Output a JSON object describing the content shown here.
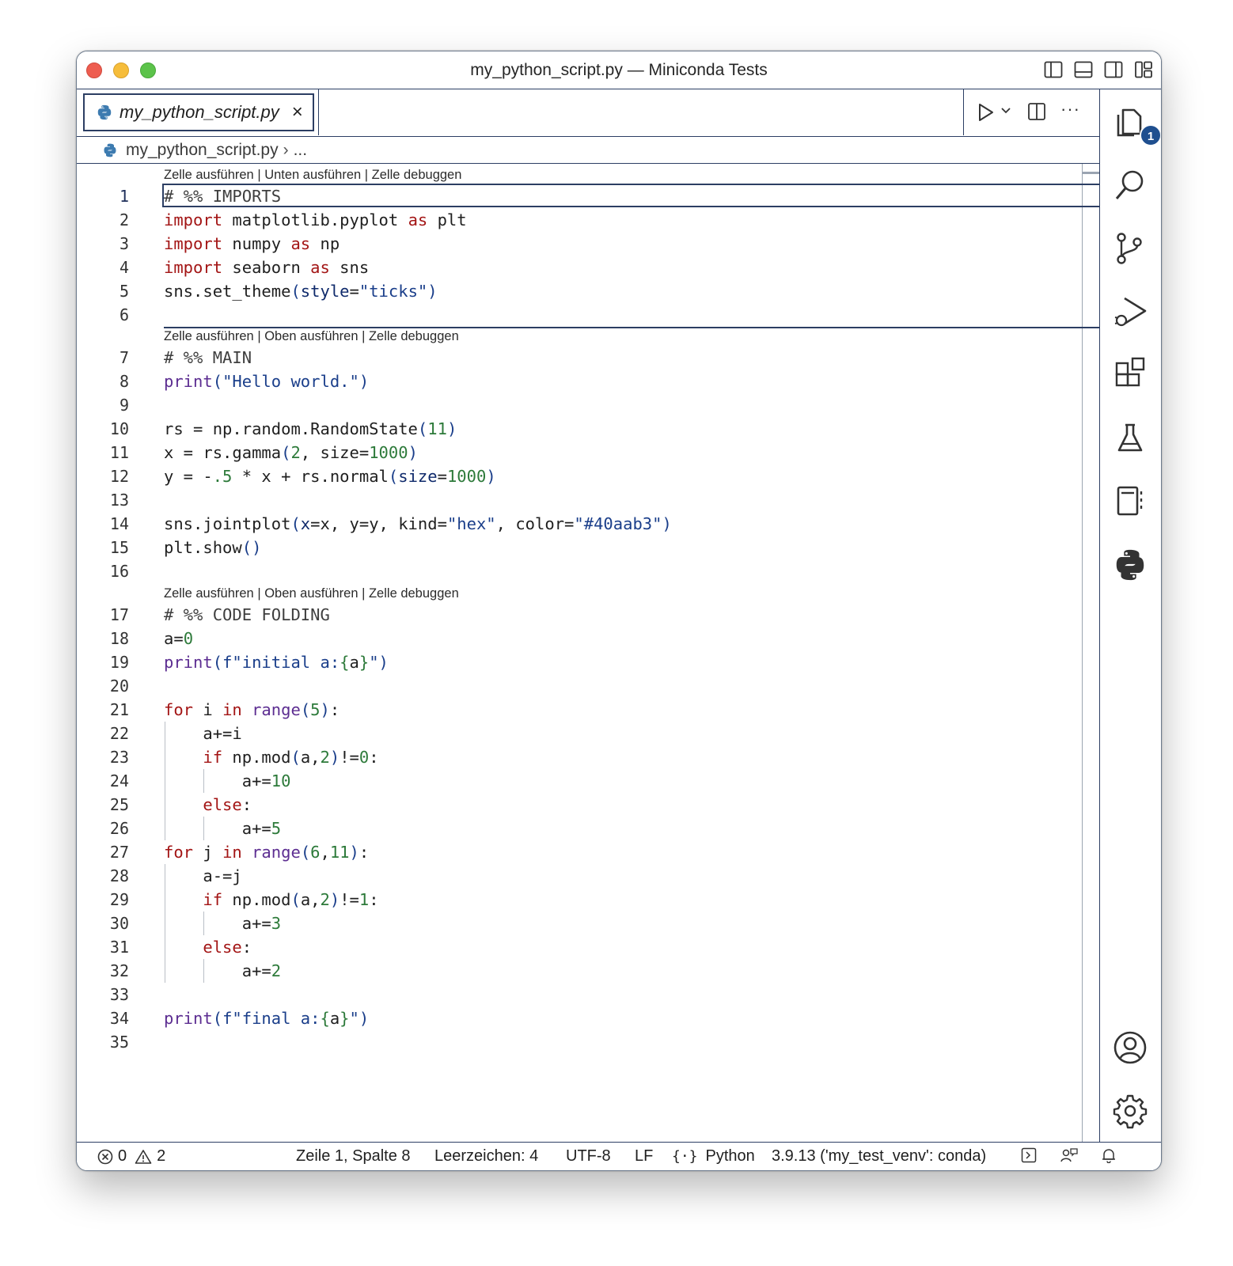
{
  "window": {
    "title": "my_python_script.py — Miniconda Tests"
  },
  "tab": {
    "filename": "my_python_script.py",
    "close_glyph": "×"
  },
  "breadcrumb": {
    "file": "my_python_script.py",
    "separator": "›",
    "more": "..."
  },
  "activity_bar": {
    "items": [
      "explorer-icon",
      "search-icon",
      "source-control-icon",
      "run-debug-icon",
      "extensions-icon",
      "testing-icon",
      "notebook-icon",
      "python-icon"
    ],
    "explorer_badge": "1",
    "bottom": [
      "accounts-icon",
      "settings-gear-icon"
    ]
  },
  "editor_actions": {
    "more": "···"
  },
  "codelens": {
    "first": "Zelle ausführen | Unten ausführen | Zelle debuggen",
    "second": "Zelle ausführen | Oben ausführen | Zelle debuggen",
    "third": "Zelle ausführen | Oben ausführen | Zelle debuggen"
  },
  "line_numbers": [
    "1",
    "2",
    "3",
    "4",
    "5",
    "6",
    "7",
    "8",
    "9",
    "10",
    "11",
    "12",
    "13",
    "14",
    "15",
    "16",
    "17",
    "18",
    "19",
    "20",
    "21",
    "22",
    "23",
    "24",
    "25",
    "26",
    "27",
    "28",
    "29",
    "30",
    "31",
    "32",
    "33",
    "34",
    "35"
  ],
  "code": [
    "# %% IMPORTS",
    "import matplotlib.pyplot as plt",
    "import numpy as np",
    "import seaborn as sns",
    "sns.set_theme(style=\"ticks\")",
    "",
    "# %% MAIN",
    "print(\"Hello world.\")",
    "",
    "rs = np.random.RandomState(11)",
    "x = rs.gamma(2, size=1000)",
    "y = -.5 * x + rs.normal(size=1000)",
    "",
    "sns.jointplot(x=x, y=y, kind=\"hex\", color=\"#40aab3\")",
    "plt.show()",
    "",
    "# %% CODE FOLDING",
    "a=0",
    "print(f\"initial a:{a}\")",
    "",
    "for i in range(5):",
    "    a+=i",
    "    if np.mod(a,2)!=0:",
    "        a+=10",
    "    else:",
    "        a+=5",
    "for j in range(6,11):",
    "    a-=j",
    "    if np.mod(a,2)!=1:",
    "        a+=3",
    "    else:",
    "        a+=2",
    "",
    "print(f\"final a:{a}\")",
    ""
  ],
  "status": {
    "errors": "0",
    "warnings": "2",
    "position": "Zeile 1, Spalte 8",
    "indent": "Leerzeichen: 4",
    "encoding": "UTF-8",
    "eol": "LF",
    "language": "Python",
    "interpreter": "3.9.13 ('my_test_venv': conda)"
  }
}
